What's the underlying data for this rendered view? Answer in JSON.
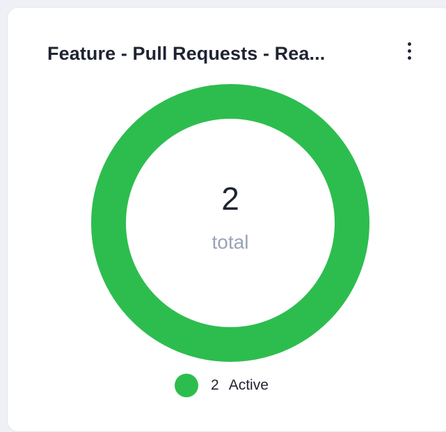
{
  "widget": {
    "title": "Feature - Pull Requests - Rea...",
    "menu_icon": "more-vertical-icon"
  },
  "chart_data": {
    "type": "pie",
    "variant": "donut",
    "total": "2",
    "total_label": "total",
    "series": [
      {
        "name": "Active",
        "value": 2,
        "count_label": "2",
        "color": "#2dbd4e"
      }
    ]
  }
}
